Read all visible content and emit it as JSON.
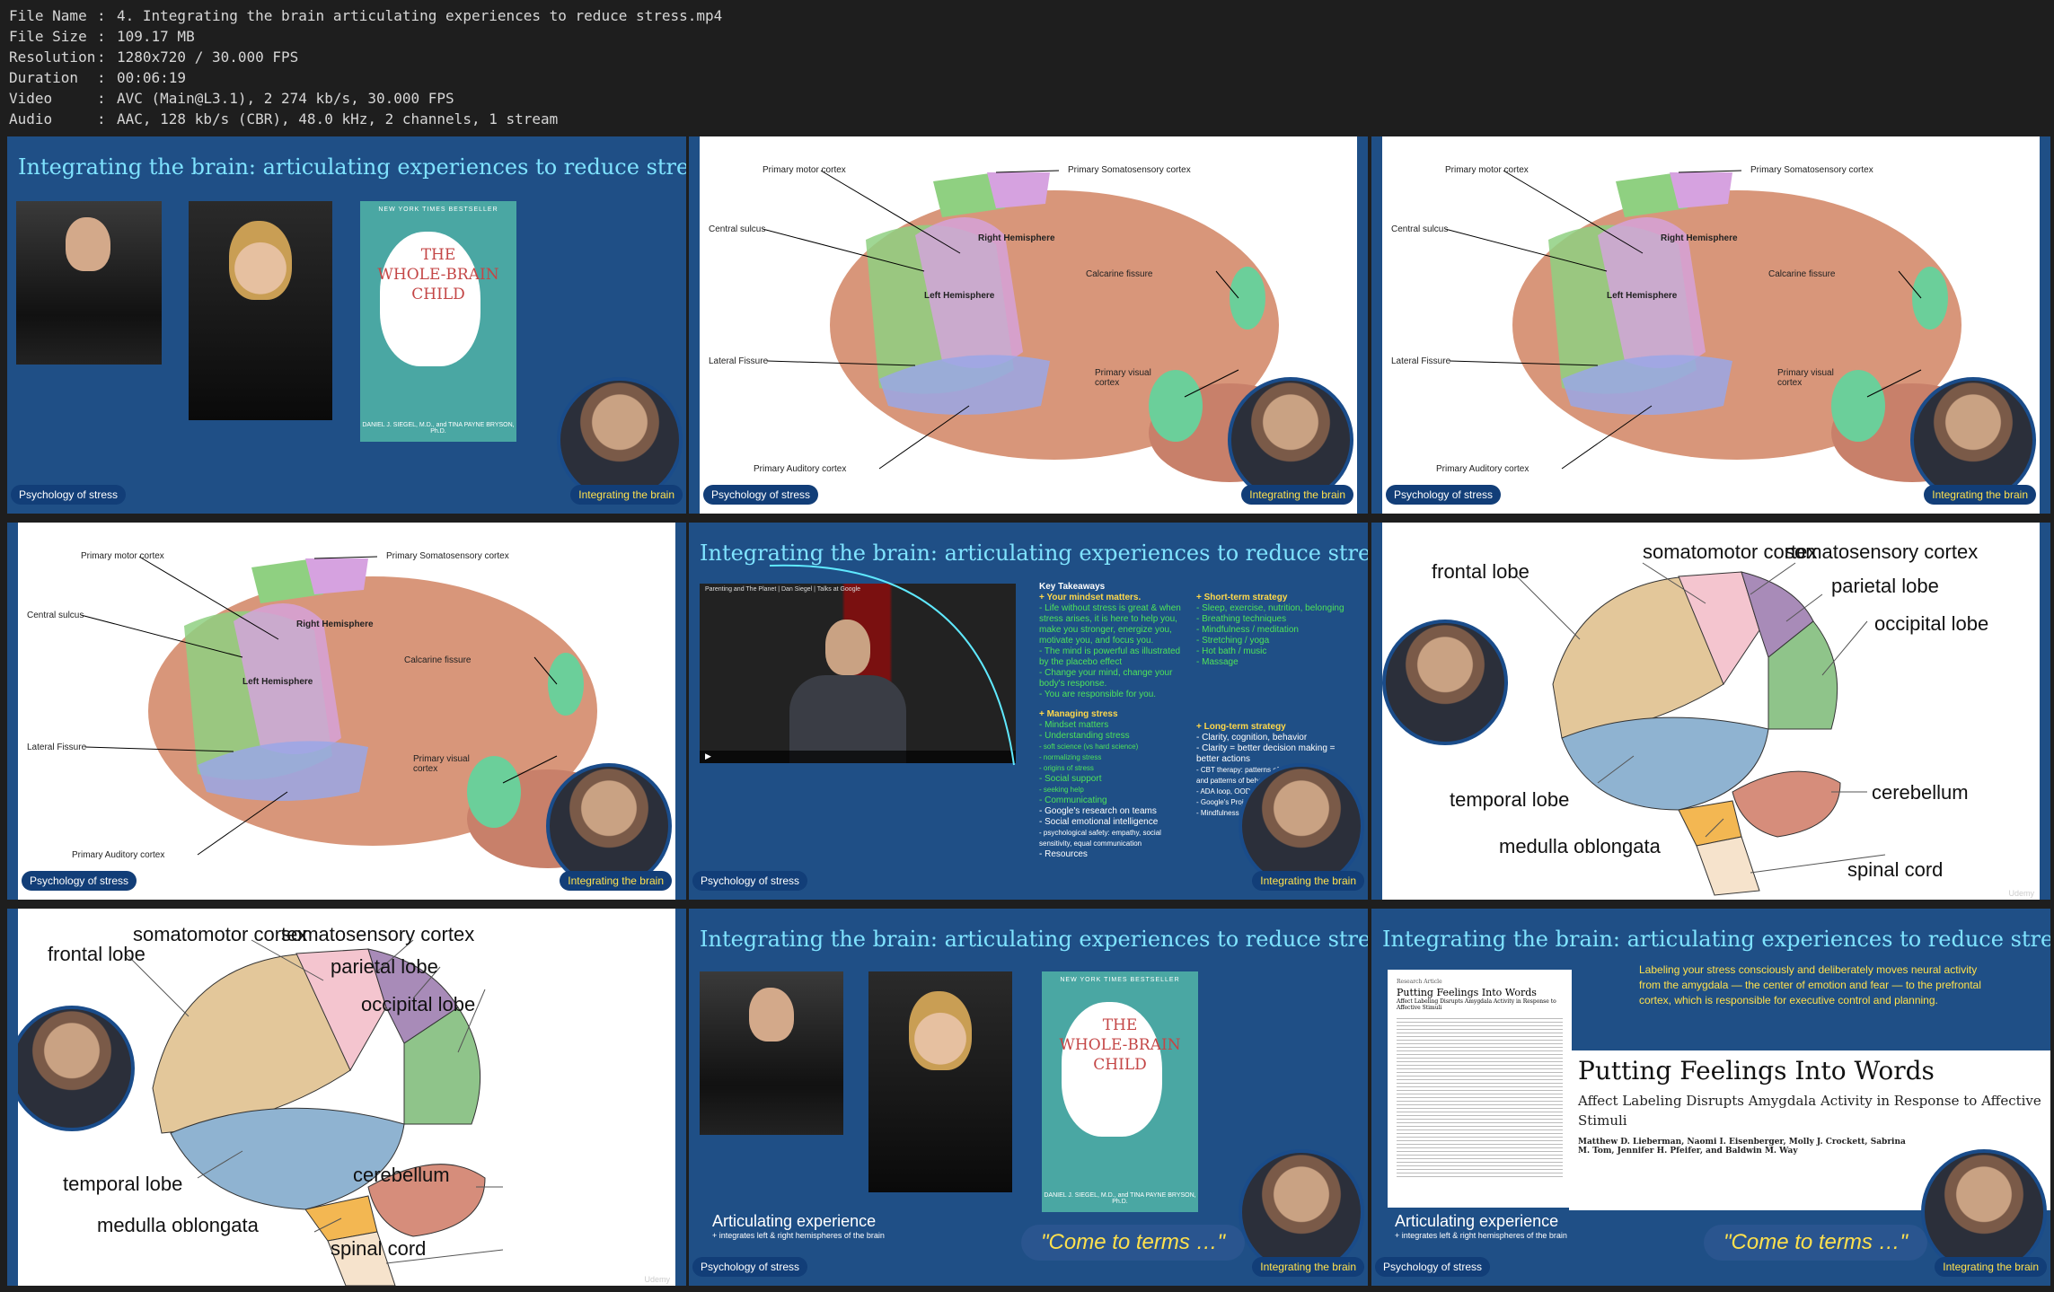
{
  "meta": {
    "rows": [
      {
        "key": "File Name",
        "value": "4. Integrating the brain articulating experiences to reduce stress.mp4"
      },
      {
        "key": "File Size",
        "value": "109.17 MB"
      },
      {
        "key": "Resolution",
        "value": "1280x720 / 30.000 FPS"
      },
      {
        "key": "Duration",
        "value": "00:06:19"
      },
      {
        "key": "Video",
        "value": "AVC (Main@L3.1), 2 274 kb/s, 30.000 FPS"
      },
      {
        "key": "Audio",
        "value": "AAC, 128 kb/s (CBR), 48.0 kHz, 2 channels, 1 stream"
      }
    ]
  },
  "slide": {
    "title": "Integrating the brain: articulating experiences to reduce stress",
    "footer_left": "Psychology of stress",
    "footer_right": "Integrating the brain",
    "watermark": "Udemy"
  },
  "book": {
    "badge": "NEW YORK TIMES BESTSELLER",
    "title_1": "THE",
    "title_2": "WHOLE-BRAIN",
    "title_3": "CHILD",
    "authors": "DANIEL J. SIEGEL, M.D., and TINA PAYNE BRYSON, Ph.D."
  },
  "brain_labels": {
    "motor": "Primary motor cortex",
    "somato": "Primary Somatosensory cortex",
    "central": "Central sulcus",
    "right_hemi": "Right Hemisphere",
    "calcarine": "Calcarine fissure",
    "left_hemi": "Left Hemisphere",
    "lateral": "Lateral Fissure",
    "visual": "Primary visual cortex",
    "auditory": "Primary Auditory cortex"
  },
  "diagram_labels": {
    "somatomotor": "somatomotor cortex",
    "somatosensory": "somatosensory cortex",
    "frontal": "frontal lobe",
    "parietal": "parietal lobe",
    "occipital": "occipital lobe",
    "temporal": "temporal lobe",
    "cerebellum": "cerebellum",
    "medulla": "medulla oblongata",
    "spinal": "spinal cord"
  },
  "video": {
    "caption": "Parenting and The Planet | Dan Siegel | Talks at Google"
  },
  "takeaways": {
    "heading": "Key Takeaways",
    "mindset": "+ Your mindset matters.",
    "mindset_items": [
      "- Life without stress is great & when",
      "stress arises, it is here to help you,",
      "make you stronger, energize you,",
      "motivate you, and focus you.",
      "- The mind is powerful as illustrated",
      "by the placebo effect",
      "- Change your mind, change your",
      "body's response.",
      "- You are responsible for you."
    ],
    "short_term": "+ Short-term strategy",
    "short_items": [
      "- Sleep, exercise, nutrition, belonging",
      "- Breathing techniques",
      "- Mindfulness / meditation",
      "- Stretching / yoga",
      "- Hot bath / music",
      "- Massage"
    ],
    "managing": "+ Managing stress",
    "managing_items": [
      "- Mindset matters",
      "- Understanding stress",
      "- soft science (vs hard science)",
      "- normalizing stress",
      "- origins of stress",
      "- Social support",
      "- seeking help",
      "- Communicating",
      "- Google's research on teams",
      "- Social emotional intelligence",
      "- psychological safety: empathy, social",
      "sensitivity, equal communication",
      "- Resources"
    ],
    "long_term": "+ Long-term strategy",
    "long_items": [
      "- Clarity, cognition, behavior",
      "- Clarity = better decision making =",
      "better actions",
      "- CBT therapy: patterns of thought",
      "and patterns of behavior",
      "- ADA loop, OODA",
      "- Google's Project",
      "- Mindfulness"
    ]
  },
  "articulating": {
    "title": "Articulating experience",
    "sub": "+ integrates left & right hemispheres of the brain",
    "quote": "\"Come to terms …\""
  },
  "paper_slide": {
    "summary": "Labeling your stress consciously and deliberately moves neural activity from the amygdala — the center of emotion and fear — to the prefrontal cortex, which is responsible for executive control and planning.",
    "title": "Putting Feelings Into Words",
    "subtitle": "Affect Labeling Disrupts Amygdala Activity in Response to Affective Stimuli",
    "authors": "Matthew D. Lieberman, Naomi I. Eisenberger, Molly J. Crockett, Sabrina M. Tom, Jennifer H. Pfeifer, and Baldwin M. Way",
    "mini_header": "Research Article",
    "mini_title": "Putting Feelings Into Words",
    "mini_sub": "Affect Labeling Disrupts Amygdala Activity in Response to Affective Stimuli"
  }
}
